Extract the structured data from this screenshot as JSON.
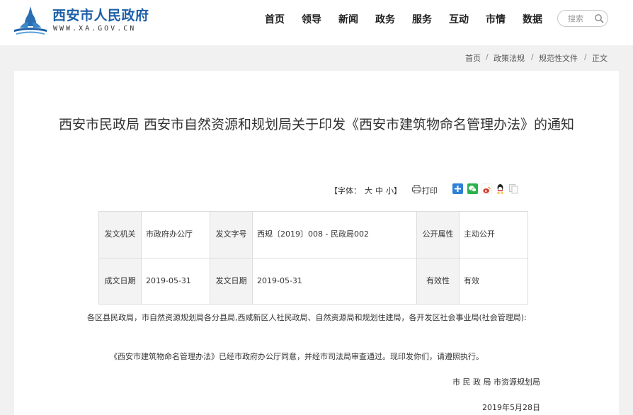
{
  "header": {
    "site_name": "西安市人民政府",
    "site_url": "WWW.XA.GOV.CN",
    "nav": [
      "首页",
      "领导",
      "新闻",
      "政务",
      "服务",
      "互动",
      "市情",
      "数据"
    ],
    "search_placeholder": "搜索"
  },
  "breadcrumb": {
    "items": [
      "首页",
      "政策法规",
      "规范性文件",
      "正文"
    ],
    "separator": "/"
  },
  "article": {
    "title": "西安市民政局 西安市自然资源和规划局关于印发《西安市建筑物命名管理办法》的通知",
    "font_tools": {
      "open": "【",
      "label": "字体：",
      "large": "大",
      "medium": "中",
      "small": "小",
      "close": "】"
    },
    "print_label": "打印",
    "share_colors": [
      "#2f7fd6",
      "#2bb24c",
      "#d33a2c",
      "#1f8fe0",
      "#dcdcdc"
    ],
    "info_table": {
      "issuer_label": "发文机关",
      "issuer_value": "市政府办公厅",
      "doc_no_label": "发文字号",
      "doc_no_value": "西规〔2019〕008 - 民政局002",
      "public_label": "公开属性",
      "public_value": "主动公开",
      "created_label": "成文日期",
      "created_value": "2019-05-31",
      "issued_label": "发文日期",
      "issued_value": "2019-05-31",
      "validity_label": "有效性",
      "validity_value": "有效"
    },
    "recipients": "各区县民政局，市自然资源规划局各分县局,西咸新区人社民政局、自然资源局和规划住建局，各开发区社会事业局(社会管理局):",
    "body": "《西安市建筑物命名管理办法》已经市政府办公厅同意，并经市司法局审查通过。现印发你们，请遵照执行。",
    "signature": "市 民 政 局 市资源规划局",
    "date": "2019年5月28日"
  },
  "colors": {
    "brand_blue": "#1d5fa8",
    "page_background": "#f1f1f1"
  }
}
